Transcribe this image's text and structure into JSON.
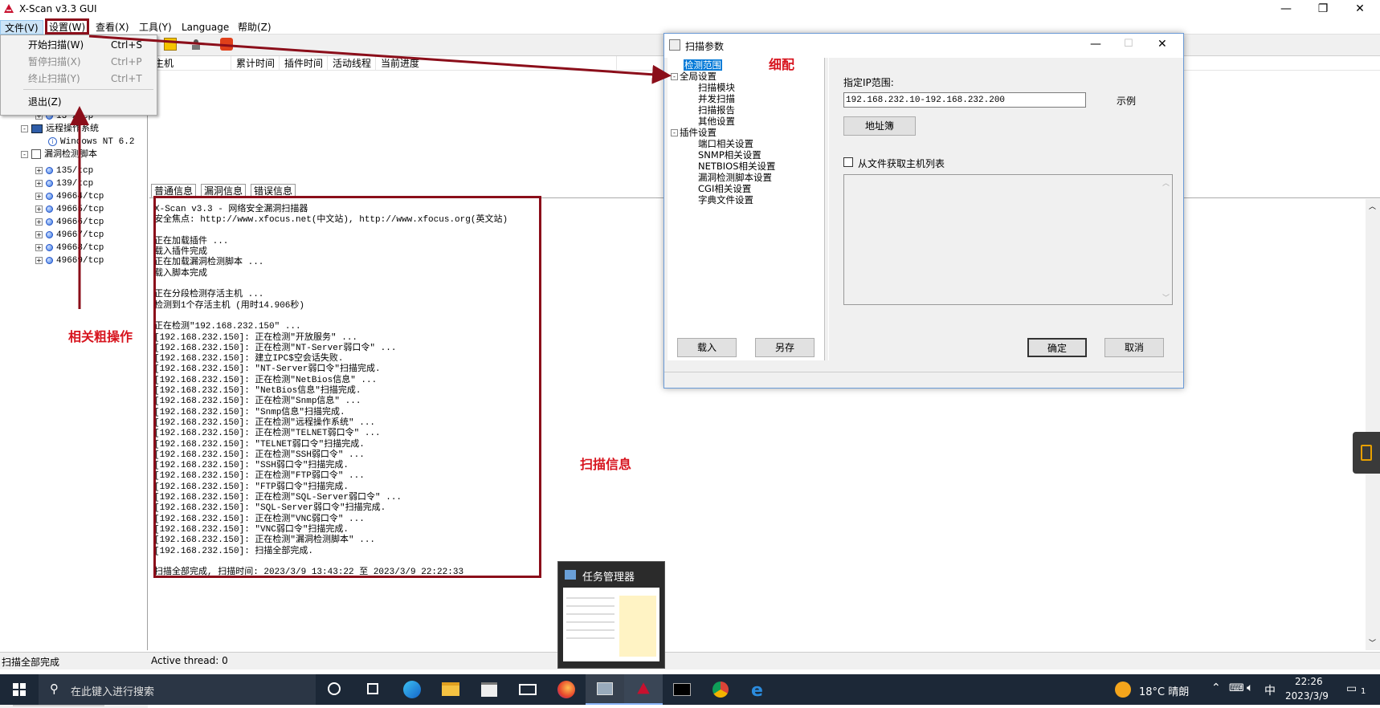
{
  "window": {
    "title": "X-Scan v3.3 GUI"
  },
  "menubar": {
    "file": "文件(V)",
    "settings": "设置(W)",
    "view": "查看(X)",
    "tools": "工具(Y)",
    "language": "Language",
    "help": "帮助(Z)"
  },
  "dropdown": {
    "items": [
      {
        "label": "开始扫描(W)",
        "shortcut": "Ctrl+S",
        "enabled": true
      },
      {
        "label": "暂停扫描(X)",
        "shortcut": "Ctrl+P",
        "enabled": false
      },
      {
        "label": "终止扫描(Y)",
        "shortcut": "Ctrl+T",
        "enabled": false
      },
      {
        "label": "退出(Z)",
        "shortcut": "",
        "enabled": true
      }
    ]
  },
  "tree": {
    "port_partial": "13 /tcp",
    "remote_os": "远程操作系统",
    "os_value": "Windows NT 6.2",
    "vuln_script": "漏洞检测脚本",
    "ports": [
      "135/tcp",
      "139/tcp",
      "49664/tcp",
      "49665/tcp",
      "49666/tcp",
      "49667/tcp",
      "49668/tcp",
      "49669/tcp"
    ]
  },
  "hostlist": {
    "columns": [
      "主机",
      "累计时间",
      "插件时间",
      "活动线程",
      "当前进度"
    ]
  },
  "tabs": [
    "普通信息",
    "漏洞信息",
    "错误信息"
  ],
  "log": {
    "lines": [
      "X-Scan v3.3 - 网络安全漏洞扫描器",
      "安全焦点: http://www.xfocus.net(中文站), http://www.xfocus.org(英文站)",
      "",
      "正在加载插件 ...",
      "载入插件完成",
      "正在加载漏洞检测脚本 ...",
      "载入脚本完成",
      "",
      "正在分段检测存活主机 ...",
      "检测到1个存活主机 (用时14.906秒)",
      "",
      "正在检测\"192.168.232.150\" ...",
      "[192.168.232.150]: 正在检测\"开放服务\" ...",
      "[192.168.232.150]: 正在检测\"NT-Server弱口令\" ...",
      "[192.168.232.150]: 建立IPC$空会话失败.",
      "[192.168.232.150]: \"NT-Server弱口令\"扫描完成.",
      "[192.168.232.150]: 正在检测\"NetBios信息\" ...",
      "[192.168.232.150]: \"NetBios信息\"扫描完成.",
      "[192.168.232.150]: 正在检测\"Snmp信息\" ...",
      "[192.168.232.150]: \"Snmp信息\"扫描完成.",
      "[192.168.232.150]: 正在检测\"远程操作系统\" ...",
      "[192.168.232.150]: 正在检测\"TELNET弱口令\" ...",
      "[192.168.232.150]: \"TELNET弱口令\"扫描完成.",
      "[192.168.232.150]: 正在检测\"SSH弱口令\" ...",
      "[192.168.232.150]: \"SSH弱口令\"扫描完成.",
      "[192.168.232.150]: 正在检测\"FTP弱口令\" ...",
      "[192.168.232.150]: \"FTP弱口令\"扫描完成.",
      "[192.168.232.150]: 正在检测\"SQL-Server弱口令\" ...",
      "[192.168.232.150]: \"SQL-Server弱口令\"扫描完成.",
      "[192.168.232.150]: 正在检测\"VNC弱口令\" ...",
      "[192.168.232.150]: \"VNC弱口令\"扫描完成.",
      "[192.168.232.150]: 正在检测\"漏洞检测脚本\" ...",
      "[192.168.232.150]: 扫描全部完成.",
      "",
      "扫描全部完成, 扫描时间: 2023/3/9 13:43:22 至 2023/3/9 22:22:33"
    ]
  },
  "status": {
    "left": "扫描全部完成",
    "thread": "Active thread: 0"
  },
  "dialog": {
    "title": "扫描参数",
    "tree": [
      {
        "label": "检测范围",
        "level": 1,
        "selected": true
      },
      {
        "label": "全局设置",
        "level": 0,
        "exp": "-"
      },
      {
        "label": "扫描模块",
        "level": 2
      },
      {
        "label": "并发扫描",
        "level": 2
      },
      {
        "label": "扫描报告",
        "level": 2
      },
      {
        "label": "其他设置",
        "level": 2
      },
      {
        "label": "插件设置",
        "level": 0,
        "exp": "-"
      },
      {
        "label": "端口相关设置",
        "level": 2
      },
      {
        "label": "SNMP相关设置",
        "level": 2
      },
      {
        "label": "NETBIOS相关设置",
        "level": 2
      },
      {
        "label": "漏洞检测脚本设置",
        "level": 2
      },
      {
        "label": "CGI相关设置",
        "level": 2
      },
      {
        "label": "字典文件设置",
        "level": 2
      }
    ],
    "ip_label": "指定IP范围:",
    "ip_value": "192.168.232.10-192.168.232.200",
    "example": "示例",
    "address_book": "地址簿",
    "from_file": "从文件获取主机列表",
    "load": "载入",
    "save_as": "另存",
    "ok": "确定",
    "cancel": "取消"
  },
  "annotations": {
    "fine": "细配",
    "coarse": "相关粗操作",
    "scaninfo": "扫描信息"
  },
  "taskbar": {
    "search_placeholder": "在此键入进行搜索",
    "preview_title": "任务管理器",
    "weather": "18°C 晴朗",
    "ime": "中",
    "time": "22:26",
    "date": "2023/3/9",
    "notif": "1"
  }
}
